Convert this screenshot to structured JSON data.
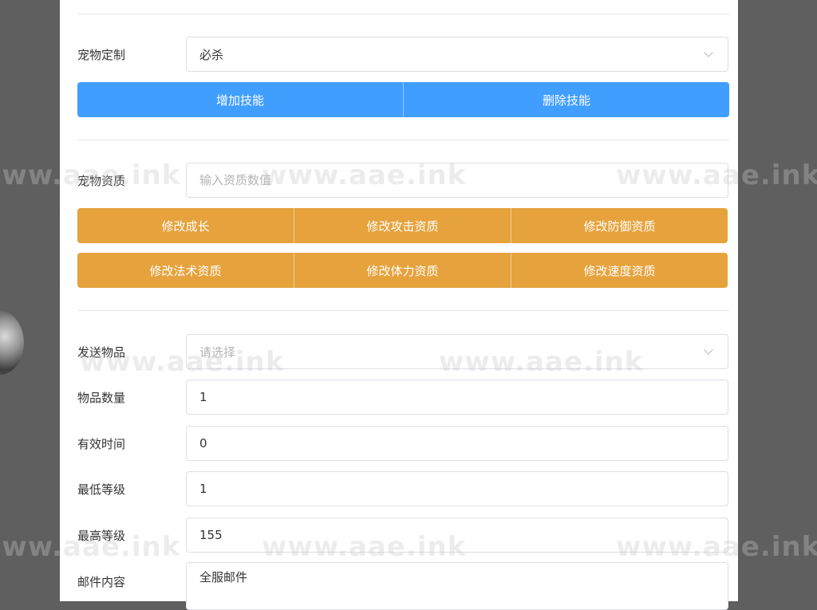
{
  "pet_custom": {
    "label": "宠物定制",
    "selected": "必杀",
    "buttons": [
      "增加技能",
      "删除技能"
    ]
  },
  "pet_aptitude": {
    "label": "宠物资质",
    "placeholder": "输入资质数值",
    "buttons_row1": [
      "修改成长",
      "修改攻击资质",
      "修改防御资质"
    ],
    "buttons_row2": [
      "修改法术资质",
      "修改体力资质",
      "修改速度资质"
    ]
  },
  "send_item": {
    "label": "发送物品",
    "placeholder": "请选择",
    "quantity_label": "物品数量",
    "quantity_value": "1",
    "valid_time_label": "有效时间",
    "valid_time_value": "0",
    "min_level_label": "最低等级",
    "min_level_value": "1",
    "max_level_label": "最高等级",
    "max_level_value": "155",
    "mail_content_label": "邮件内容",
    "mail_content_value": "全服邮件"
  },
  "watermark": "www.aae.ink",
  "colors": {
    "primary": "#409eff",
    "warning": "#e6a23c",
    "backdrop": "#5f5f5f",
    "border": "#dcdfe6"
  }
}
